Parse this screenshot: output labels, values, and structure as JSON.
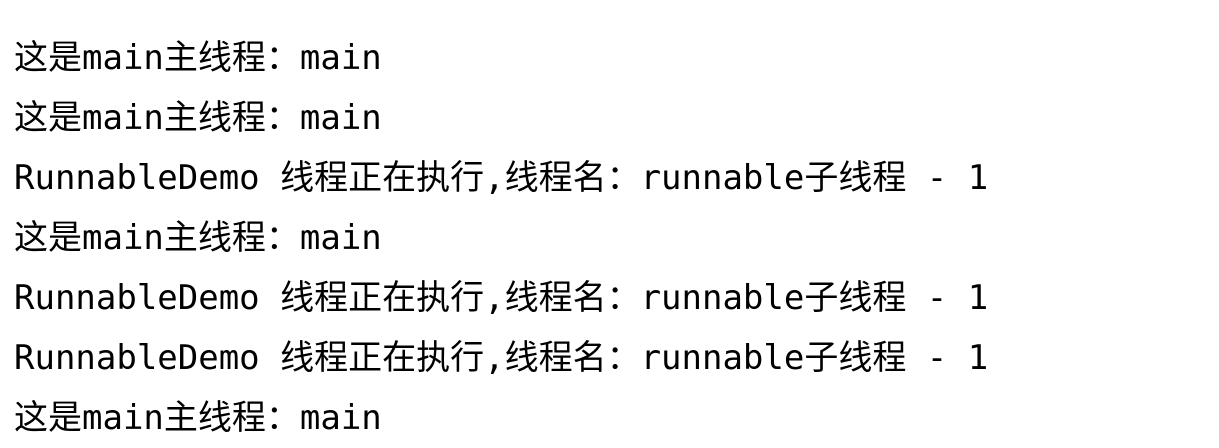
{
  "console": {
    "lines": [
      "这是main主线程：main",
      "这是main主线程：main",
      "RunnableDemo 线程正在执行,线程名：runnable子线程 - 1",
      "这是main主线程：main",
      "RunnableDemo 线程正在执行,线程名：runnable子线程 - 1",
      "RunnableDemo 线程正在执行,线程名：runnable子线程 - 1",
      "这是main主线程：main"
    ]
  }
}
